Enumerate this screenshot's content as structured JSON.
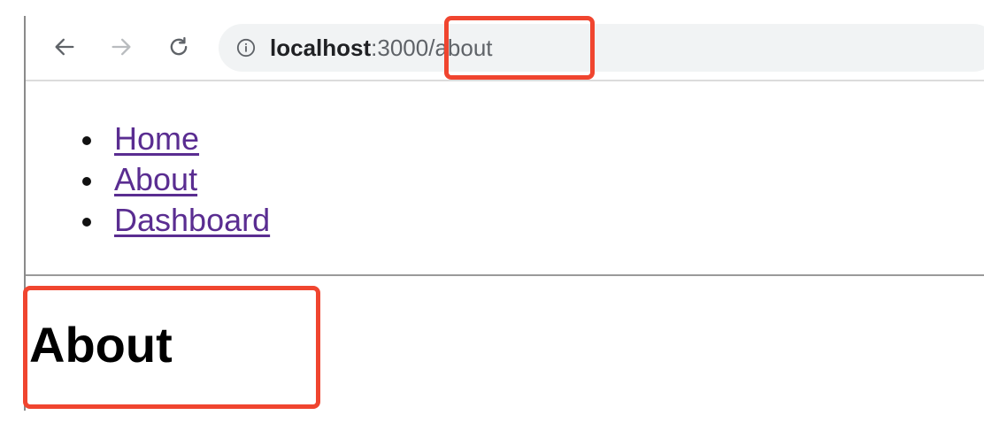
{
  "browser": {
    "url_host": "localhost",
    "url_port": ":3000",
    "url_path": "/about",
    "icons": {
      "back": "arrow-left-icon",
      "forward": "arrow-right-icon",
      "reload": "reload-icon",
      "info": "info-circle-icon"
    }
  },
  "nav": {
    "items": [
      {
        "label": "Home"
      },
      {
        "label": "About"
      },
      {
        "label": "Dashboard"
      }
    ]
  },
  "page": {
    "heading": "About"
  },
  "annotations": {
    "highlight_color": "#f0452f"
  }
}
